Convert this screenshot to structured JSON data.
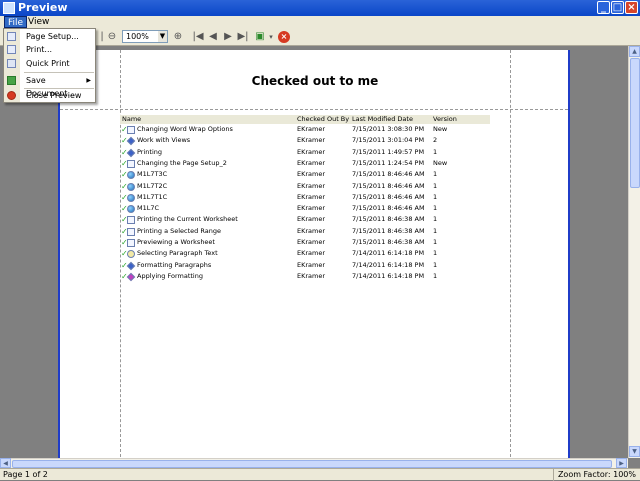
{
  "window": {
    "title": "Preview"
  },
  "menu": {
    "file": "File",
    "view": "View"
  },
  "file_menu": {
    "page_setup": "Page Setup...",
    "print": "Print...",
    "quick_print": "Quick Print",
    "save_document": "Save Document...",
    "close_preview": "Close Preview"
  },
  "toolbar": {
    "zoom_value": "100%"
  },
  "report": {
    "title": "Checked out to me",
    "columns": {
      "name": "Name",
      "checked_out_by": "Checked Out By",
      "last_modified": "Last Modified Date",
      "version": "Version"
    },
    "rows": [
      {
        "name": "Changing Word Wrap Options",
        "by": "EKramer",
        "date": "7/15/2011 3:08:30 PM",
        "ver": "New",
        "icon": "document-icon"
      },
      {
        "name": "Work with Views",
        "by": "EKramer",
        "date": "7/15/2011 3:01:04 PM",
        "ver": "2",
        "icon": "workflow-icon"
      },
      {
        "name": "Printing",
        "by": "EKramer",
        "date": "7/15/2011 1:49:57 PM",
        "ver": "1",
        "icon": "workflow-icon"
      },
      {
        "name": "Changing the Page Setup_2",
        "by": "EKramer",
        "date": "7/15/2011 1:24:54 PM",
        "ver": "New",
        "icon": "document-icon"
      },
      {
        "name": "M1L7T3C",
        "by": "EKramer",
        "date": "7/15/2011 8:46:46 AM",
        "ver": "1",
        "icon": "globe-icon"
      },
      {
        "name": "M1L7T2C",
        "by": "EKramer",
        "date": "7/15/2011 8:46:46 AM",
        "ver": "1",
        "icon": "globe-icon"
      },
      {
        "name": "M1L7T1C",
        "by": "EKramer",
        "date": "7/15/2011 8:46:46 AM",
        "ver": "1",
        "icon": "globe-icon"
      },
      {
        "name": "M1L7C",
        "by": "EKramer",
        "date": "7/15/2011 8:46:46 AM",
        "ver": "1",
        "icon": "globe-icon"
      },
      {
        "name": "Printing the Current Worksheet",
        "by": "EKramer",
        "date": "7/15/2011 8:46:38 AM",
        "ver": "1",
        "icon": "document-icon"
      },
      {
        "name": "Printing a Selected Range",
        "by": "EKramer",
        "date": "7/15/2011 8:46:38 AM",
        "ver": "1",
        "icon": "document-icon"
      },
      {
        "name": "Previewing a Worksheet",
        "by": "EKramer",
        "date": "7/15/2011 8:46:38 AM",
        "ver": "1",
        "icon": "document-icon"
      },
      {
        "name": "Selecting Paragraph Text",
        "by": "EKramer",
        "date": "7/14/2011 6:14:18 PM",
        "ver": "1",
        "icon": "search-icon"
      },
      {
        "name": "Formatting Paragraphs",
        "by": "EKramer",
        "date": "7/14/2011 6:14:18 PM",
        "ver": "1",
        "icon": "workflow-icon"
      },
      {
        "name": "Applying Formatting",
        "by": "EKramer",
        "date": "7/14/2011 6:14:18 PM",
        "ver": "1",
        "icon": "pink-workflow-icon"
      }
    ]
  },
  "status": {
    "page": "Page 1 of 2",
    "zoom": "Zoom Factor: 100%"
  }
}
